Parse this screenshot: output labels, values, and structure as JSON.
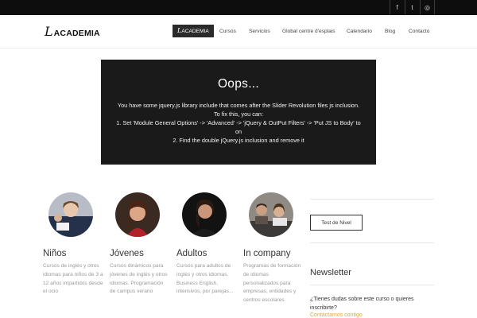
{
  "topbar": {
    "social": [
      {
        "icon": "facebook-icon",
        "glyph": "f"
      },
      {
        "icon": "twitter-icon",
        "glyph": "t"
      },
      {
        "icon": "instagram-icon",
        "glyph": "◎"
      }
    ]
  },
  "header": {
    "logo_mark": "L",
    "logo_text": "ACADEMIA",
    "nav": {
      "home_mark": "L",
      "home_text": "ACADEMIA",
      "items": [
        "Cursos",
        "Servicios",
        "Global centre d'esplais",
        "Calendario",
        "Blog",
        "Contacto"
      ]
    }
  },
  "error_box": {
    "title": "Oops...",
    "lines": [
      "You have some jquery.js library include that comes after the Slider Revolution files js inclusion.",
      "To fix this, you can:",
      "1. Set 'Module General Options' -> 'Advanced' -> 'jQuery & OutPut Filters' -> 'Put JS to Body' to",
      "on",
      "2. Find the double jQuery.js inclusion and remove it"
    ]
  },
  "cards": [
    {
      "title": "Niños",
      "text": "Cursos de inglés y otros idiomas para niños de 3 a 12 años impartidos desde el ocio"
    },
    {
      "title": "Jóvenes",
      "text": "Cursos dinámicos para jóvenes de inglés y otros idiomas. Programación de campus verano"
    },
    {
      "title": "Adultos",
      "text": "Cursos para adultos de inglés y otros idiomas. Business English, intensivos, por parejas..."
    },
    {
      "title": "In company",
      "text": "Programas de formación de idiomas personalizados para empresas, entidades y centros escolares"
    }
  ],
  "sidebar": {
    "test_button": "Test de Nivel",
    "newsletter_title": "Newsletter",
    "newsletter_question": "¿Tienes dudas sobre este curso o quieres inscribirte?",
    "contact_link": "Contáctamos contigo"
  },
  "colors": {
    "topbar": "#0d0d0d",
    "error_box": "#1a1a1a",
    "accent_link": "#e2a63a"
  }
}
